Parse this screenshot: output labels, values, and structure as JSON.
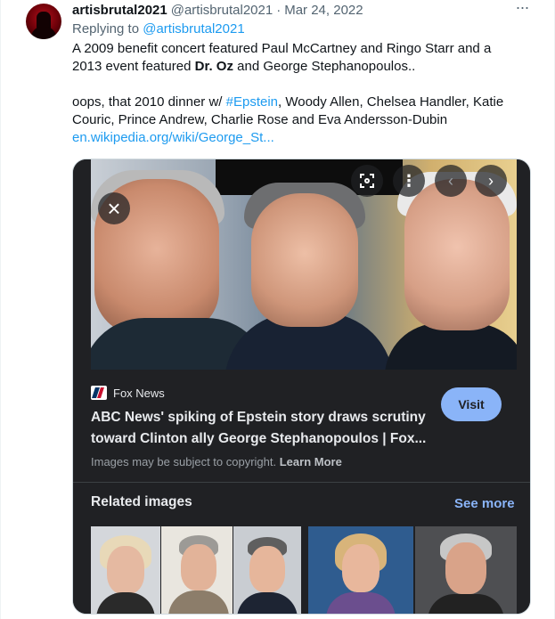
{
  "tweet": {
    "display_name": "artisbrutal2021",
    "handle": "@artisbrutal2021",
    "separator": "·",
    "date": "Mar 24, 2022",
    "more_icon": "more-horizontal-icon",
    "replying_prefix": "Replying to",
    "replying_handle": "@artisbrutal2021",
    "line1": "A 2009 benefit concert featured Paul McCartney and Ringo Starr and a",
    "line2_pre": "2013 event featured ",
    "line2_bold": "Dr. Oz",
    "line2_post": " and George Stephanopoulos..",
    "line3_pre": "oops, that 2010 dinner w/ ",
    "line3_hashtag": "#Epstein",
    "line3_post": ", Woody Allen, Chelsea Handler, Katie",
    "line4": "Couric, Prince Andrew, Charlie Rose and Eva Andersson-Dubin",
    "link": "en.wikipedia.org/wiki/George_St..."
  },
  "card": {
    "close_icon": "close-icon",
    "close_glyph": "×",
    "lens_icon": "lens-icon",
    "kebab_icon": "more-vertical-icon",
    "kebab_glyph": "⋮",
    "prev_icon": "chevron-left-icon",
    "prev_glyph": "‹",
    "next_icon": "chevron-right-icon",
    "next_glyph": "›",
    "source_name": "Fox News",
    "title_line1": "ABC News' spiking of Epstein story draws scrutiny",
    "title_line2": "toward Clinton ally George Stephanopoulos | Fox...",
    "visit_label": "Visit",
    "copyright_text": "Images may be subject to copyright.",
    "learn_more": "Learn More",
    "related_title": "Related images",
    "see_more": "See more"
  },
  "colors": {
    "link_blue": "#1d9bf0",
    "panel_bg": "#202124",
    "accent_blue": "#8ab4f8"
  }
}
